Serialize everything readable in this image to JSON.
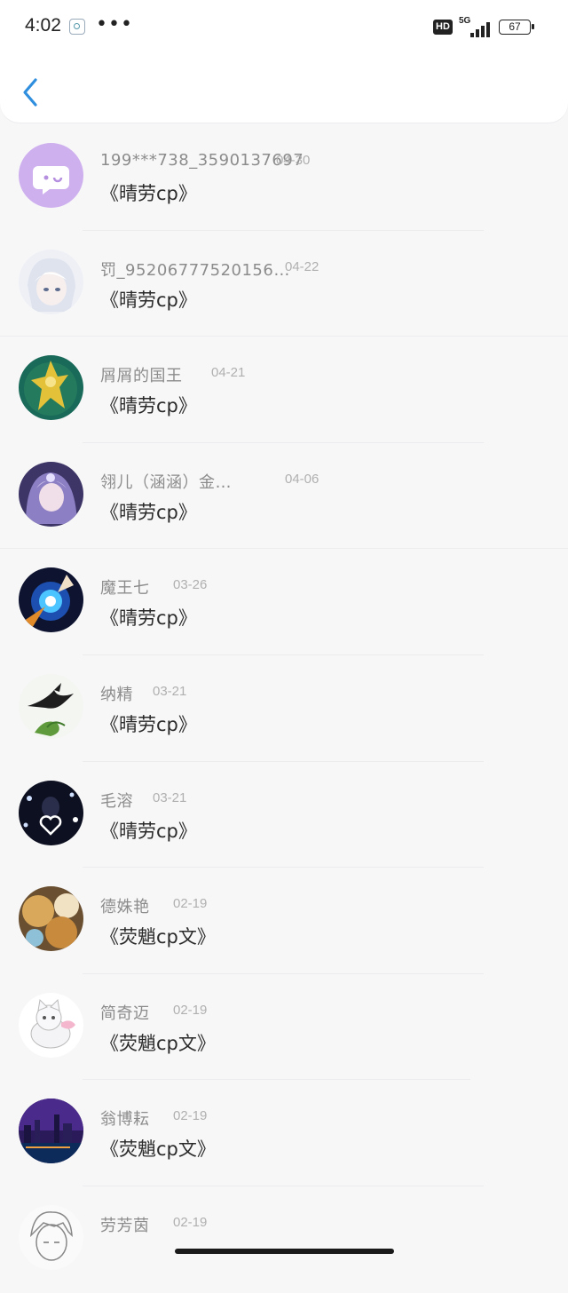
{
  "status_bar": {
    "time": "4:02",
    "more": "•••",
    "hd": "HD",
    "network": "5G",
    "battery": "67"
  },
  "items": [
    {
      "username": "199***738_3590137697",
      "date": "04-30",
      "title": "《晴劳cp》",
      "avatar_icon": "chat-bubble-icon"
    },
    {
      "username": "罚_95206777520156…",
      "date": "04-22",
      "title": "《晴劳cp》",
      "avatar_icon": "anime-white-hair-avatar"
    },
    {
      "username": "屑屑的国王",
      "date": "04-21",
      "title": "《晴劳cp》",
      "avatar_icon": "golden-warrior-avatar"
    },
    {
      "username": "翎儿（涵涵）金…",
      "date": "04-06",
      "title": "《晴劳cp》",
      "avatar_icon": "anime-girl-avatar"
    },
    {
      "username": "魔王七",
      "date": "03-26",
      "title": "《晴劳cp》",
      "avatar_icon": "energy-orb-avatar"
    },
    {
      "username": "纳精",
      "date": "03-21",
      "title": "《晴劳cp》",
      "avatar_icon": "swallow-bird-avatar"
    },
    {
      "username": "毛溶",
      "date": "03-21",
      "title": "《晴劳cp》",
      "avatar_icon": "heart-lights-avatar"
    },
    {
      "username": "德姝艳",
      "date": "02-19",
      "title": "《荧魈cp文》",
      "avatar_icon": "food-avatar"
    },
    {
      "username": "简奇迈",
      "date": "02-19",
      "title": "《荧魈cp文》",
      "avatar_icon": "white-cat-avatar"
    },
    {
      "username": "翁博耘",
      "date": "02-19",
      "title": "《荧魈cp文》",
      "avatar_icon": "city-night-avatar"
    },
    {
      "username": "劳芳茵",
      "date": "02-19",
      "title": "",
      "avatar_icon": "sketch-boy-avatar"
    }
  ]
}
